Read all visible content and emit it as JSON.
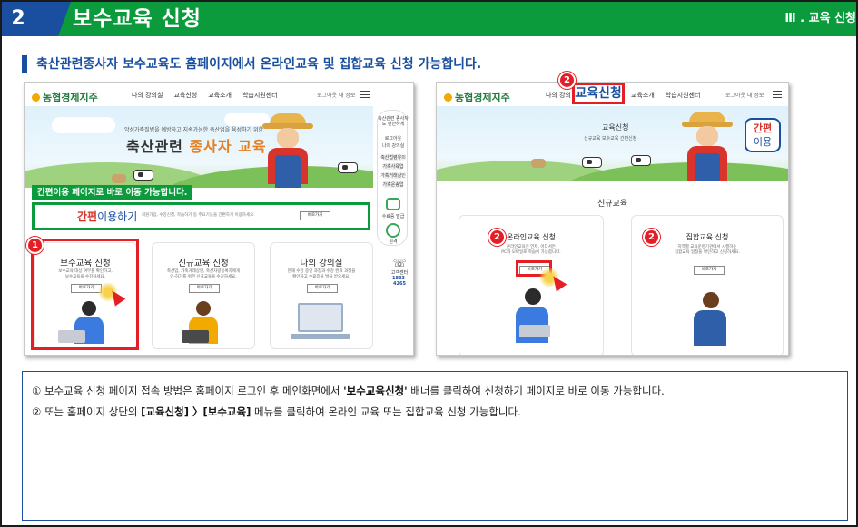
{
  "banner": {
    "number": "2",
    "title": "보수교육 신청",
    "section": "Ⅲ . 교육 신청"
  },
  "headline": "축산관련종사자 보수교육도 홈페이지에서 온라인교육 및 집합교육 신청 가능합니다.",
  "left_shot": {
    "logo": "농협경제지주",
    "nav": [
      "나의 강의실",
      "교육신청",
      "교육소개",
      "학습지원센터"
    ],
    "util": "로그아웃   내 정보",
    "hero_sub": "악성가축질병을 예방하고 지속가능한 축산업을 육성하기 위한",
    "hero_title_prefix": "축산관련 ",
    "hero_title_highlight": "종사자 교육",
    "callout": "간편이용 페이지로 바로 이동 가능합니다.",
    "easy_label_a": "간편",
    "easy_label_b": "이용하기",
    "easy_desc": "회원가입, 수강신청, 학습하기 등 주요기능을 간편하게 이용하세요.",
    "go_button": "바로가기",
    "side_quick": {
      "title": "축산관련 종사자도 편안하게",
      "login": "로그아웃",
      "my": "나의 강의실",
      "items": [
        "축산법령유의",
        "가축사육업",
        "가축거래상인",
        "가축운송업"
      ],
      "cert": "수료증 발급",
      "help": "원격",
      "phone_label": "고객센터",
      "phone_number": "1833-4265"
    },
    "cards": [
      {
        "title": "보수교육 신청",
        "desc1": "보수교육 대상 여부를 확인하고,",
        "desc2": "보수교육을 수강하세요.",
        "btn": "바로가기"
      },
      {
        "title": "신규교육 신청",
        "desc1": "축산업, 가축거래상인, 축산차량등록자에게",
        "desc2": "인·허가를 위한 신규교육을 수강하세요.",
        "btn": "바로가기"
      },
      {
        "title": "나의 강의실",
        "desc1": "현재 수강 중인 과정과 수강 완료 과정을",
        "desc2": "확인하고 수료증을 발급 받으세요.",
        "btn": "바로가기"
      }
    ],
    "badge": "1"
  },
  "right_shot": {
    "logo": "농협경제지주",
    "nav_first": "나의 강의",
    "nav_highlight": "교육신청",
    "nav_rest": [
      "교육소개",
      "학습지원센터"
    ],
    "util": "로그아웃   내 정보",
    "hero_title": "교육신청",
    "hero_crumbs": "신규교육   보수교육   간편신청",
    "easy_a": "간편",
    "easy_b": "이용",
    "section": "신규교육",
    "cards": [
      {
        "title": "온라인교육 신청",
        "desc1": "온라인교육은 언제, 어디서든",
        "desc2": "PC와 모바일로 학습이 가능합니다.",
        "btn": "바로가기"
      },
      {
        "title": "집합교육 신청",
        "desc1": "지역별 교육운영기관에서 시행하는",
        "desc2": "집합교육 일정을 확인하고 신청하세요.",
        "btn": "바로가기"
      }
    ],
    "badge": "2"
  },
  "notes": {
    "line1_a": "① 보수교육 신청 페이지 접속 방법은 홈페이지 로그인 후 메인화면에서 ",
    "line1_b": "'보수교육신청'",
    "line1_c": " 배너를 클릭하여 신청하기 페이지로 바로 이동 가능합니다.",
    "line2_a": "② 또는 홈페이지 상단의 ",
    "line2_b": "[교육신청] 〉[보수교육]",
    "line2_c": " 메뉴를 클릭하여 온라인 교육 또는 집합교육 신청 가능합니다."
  },
  "colors": {
    "banner_green": "#0b9a3c",
    "navy": "#1a4fa0",
    "highlight_red": "#e41e25"
  }
}
